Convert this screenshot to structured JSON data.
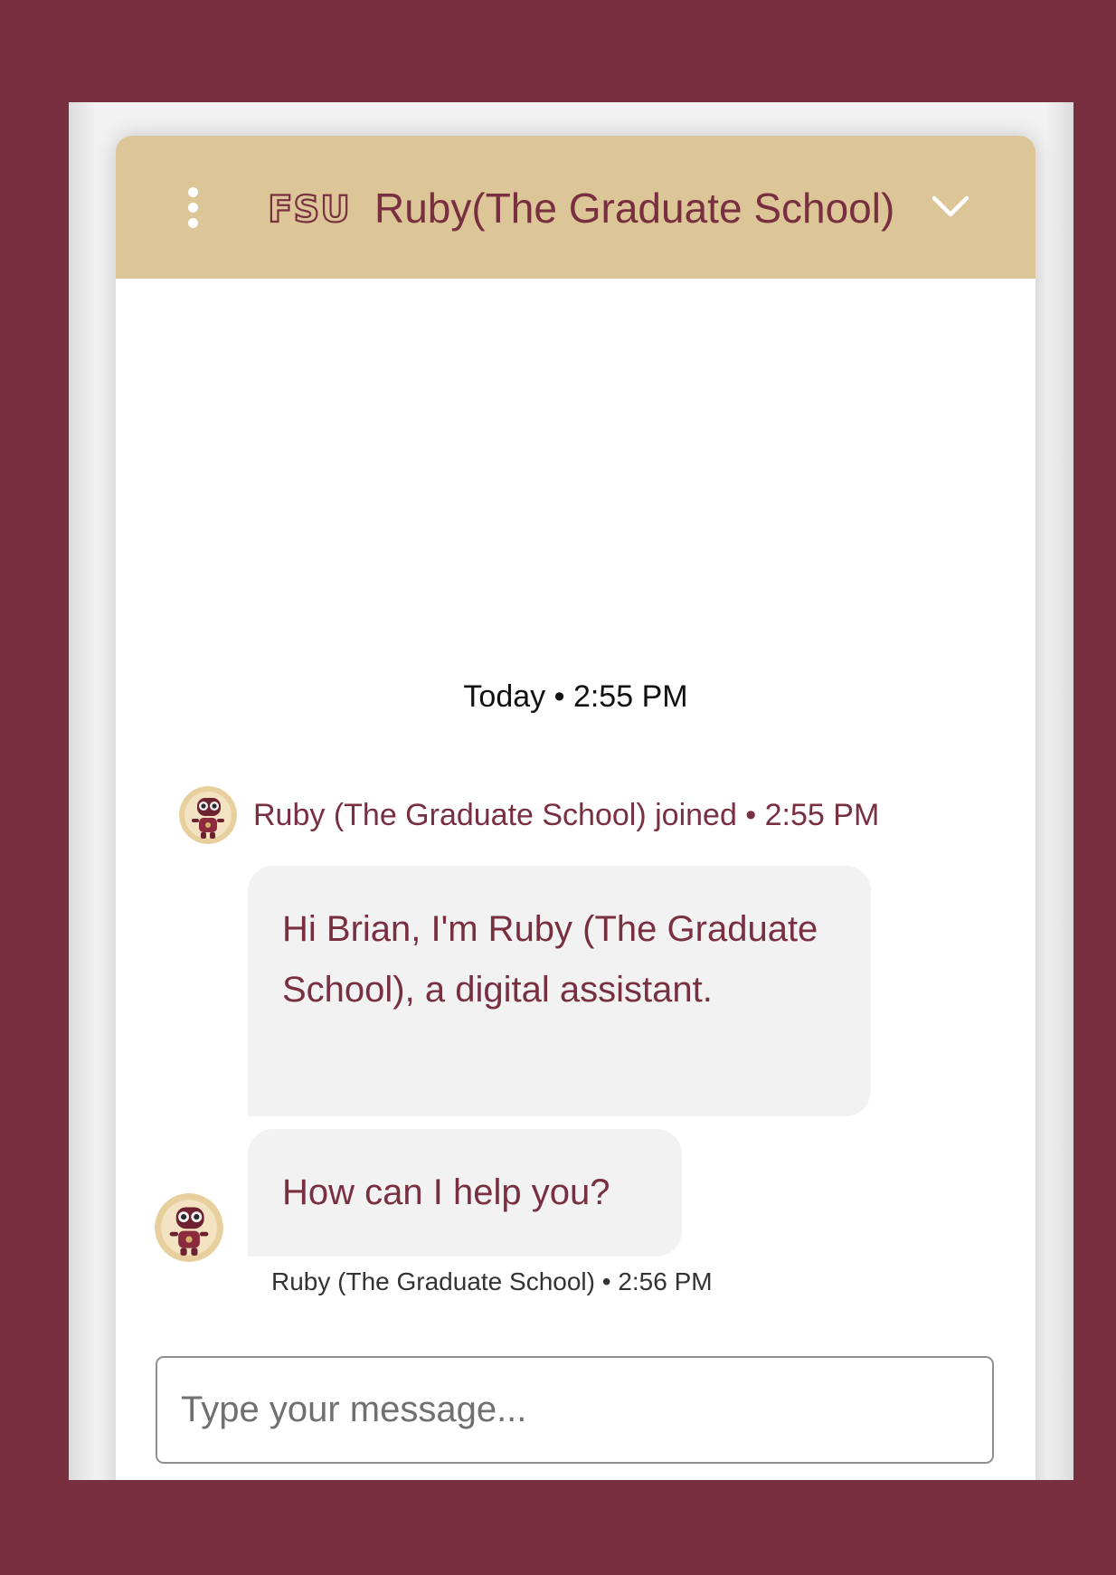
{
  "colors": {
    "brand_garnet": "#782f40",
    "brand_gold": "#dcc596",
    "bubble_bg": "#f2f2f2"
  },
  "header": {
    "menu_icon": "vertical-ellipsis-icon",
    "logo_text": "FSU",
    "title": "Ruby(The Graduate School)",
    "collapse_icon": "chevron-down-icon"
  },
  "conversation": {
    "date_separator": "Today • 2:55 PM",
    "joined_notice": "Ruby (The Graduate School) joined • 2:55 PM",
    "messages": [
      {
        "text": "Hi Brian, I'm Ruby (The Graduate School), a digital assistant."
      },
      {
        "text": "How can I help you?"
      }
    ],
    "sender_line": "Ruby (The Graduate School) • 2:56 PM"
  },
  "composer": {
    "placeholder": "Type your message...",
    "value": ""
  }
}
